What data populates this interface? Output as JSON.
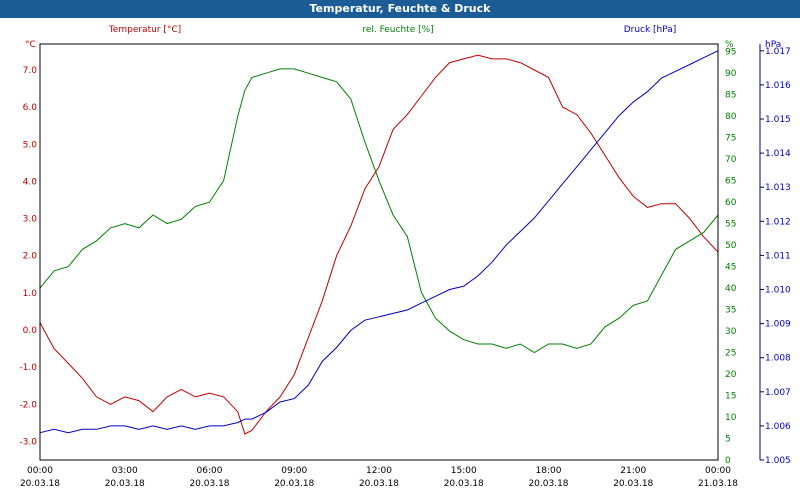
{
  "title": "Temperatur, Feuchte & Druck",
  "chart_data": {
    "type": "line",
    "title": "Temperatur, Feuchte & Druck",
    "x_ticks": [
      {
        "time": "00:00",
        "date": "20.03.18"
      },
      {
        "time": "03:00",
        "date": "20.03.18"
      },
      {
        "time": "06:00",
        "date": "20.03.18"
      },
      {
        "time": "09:00",
        "date": "20.03.18"
      },
      {
        "time": "12:00",
        "date": "20.03.18"
      },
      {
        "time": "15:00",
        "date": "20.03.18"
      },
      {
        "time": "18:00",
        "date": "20.03.18"
      },
      {
        "time": "21:00",
        "date": "20.03.18"
      },
      {
        "time": "00:00",
        "date": "21.03.18"
      }
    ],
    "x": [
      0,
      0.5,
      1,
      1.5,
      2,
      2.5,
      3,
      3.5,
      4,
      4.5,
      5,
      5.5,
      6,
      6.5,
      7,
      7.25,
      7.5,
      8,
      8.5,
      9,
      9.5,
      10,
      10.5,
      11,
      11.5,
      12,
      12.5,
      13,
      13.5,
      14,
      14.5,
      15,
      15.5,
      16,
      16.5,
      17,
      17.5,
      18,
      18.5,
      19,
      19.5,
      20,
      20.5,
      21,
      21.5,
      22,
      22.5,
      23,
      23.5,
      24
    ],
    "axes": {
      "temperature": {
        "label": "Temperatur [°C]",
        "unit": "°C",
        "ticks": [
          -3.0,
          -2.0,
          -1.0,
          0.0,
          1.0,
          2.0,
          3.0,
          4.0,
          5.0,
          6.0,
          7.0
        ],
        "color": "#c00000"
      },
      "humidity": {
        "label": "rel. Feuchte [%]",
        "unit": "%",
        "ticks": [
          0,
          5,
          10,
          15,
          20,
          25,
          30,
          35,
          40,
          45,
          50,
          55,
          60,
          65,
          70,
          75,
          80,
          85,
          90,
          95
        ],
        "color": "#008000"
      },
      "pressure": {
        "label": "Druck [hPa]",
        "unit": "hPa",
        "ticks": [
          1.005,
          1.006,
          1.007,
          1.008,
          1.009,
          1.01,
          1.011,
          1.012,
          1.013,
          1.014,
          1.015,
          1.016,
          1.017
        ],
        "color": "#0000c0"
      }
    },
    "series": [
      {
        "name": "Temperatur [°C]",
        "axis": "temperature",
        "color": "#c00000",
        "values": [
          0.2,
          -0.5,
          -0.9,
          -1.3,
          -1.8,
          -2.0,
          -1.8,
          -1.9,
          -2.2,
          -1.8,
          -1.6,
          -1.8,
          -1.7,
          -1.8,
          -2.2,
          -2.8,
          -2.7,
          -2.2,
          -1.8,
          -1.2,
          -0.2,
          0.8,
          2.0,
          2.8,
          3.8,
          4.4,
          5.4,
          5.8,
          6.3,
          6.8,
          7.2,
          7.3,
          7.4,
          7.3,
          7.3,
          7.2,
          7.0,
          6.8,
          6.0,
          5.8,
          5.3,
          4.7,
          4.1,
          3.6,
          3.3,
          3.4,
          3.4,
          3.0,
          2.5,
          2.1
        ]
      },
      {
        "name": "rel. Feuchte [%]",
        "axis": "humidity",
        "color": "#008000",
        "values": [
          40,
          44,
          45,
          49,
          51,
          54,
          55,
          54,
          57,
          55,
          56,
          59,
          60,
          65,
          80,
          86,
          89,
          90,
          91,
          91,
          90,
          89,
          88,
          84,
          74,
          65,
          57,
          52,
          39,
          33,
          30,
          28,
          27,
          27,
          26,
          27,
          25,
          27,
          27,
          26,
          27,
          31,
          33,
          36,
          37,
          43,
          49,
          51,
          53,
          57
        ]
      },
      {
        "name": "Druck [hPa]",
        "axis": "pressure",
        "color": "#0000c0",
        "values": [
          1.0058,
          1.0059,
          1.0058,
          1.0059,
          1.0059,
          1.006,
          1.006,
          1.0059,
          1.006,
          1.0059,
          1.006,
          1.0059,
          1.006,
          1.006,
          1.0061,
          1.0062,
          1.0062,
          1.0064,
          1.0067,
          1.0068,
          1.0072,
          1.0079,
          1.0083,
          1.0088,
          1.0091,
          1.0092,
          1.0093,
          1.0094,
          1.0096,
          1.0098,
          1.01,
          1.0101,
          1.0104,
          1.0108,
          1.0113,
          1.0117,
          1.0121,
          1.0126,
          1.0131,
          1.0136,
          1.0141,
          1.0146,
          1.0151,
          1.0155,
          1.0158,
          1.0162,
          1.0164,
          1.0166,
          1.0168,
          1.017
        ]
      }
    ],
    "xlim": [
      0,
      24
    ],
    "grid": true
  }
}
